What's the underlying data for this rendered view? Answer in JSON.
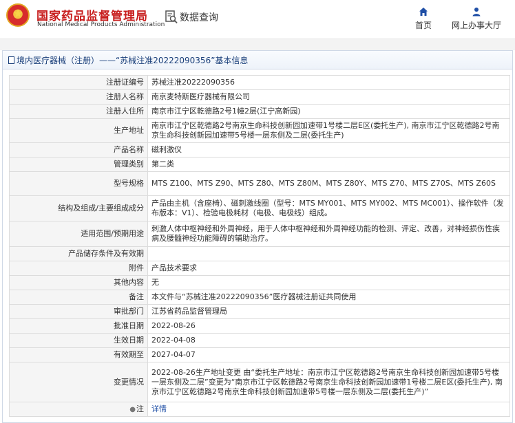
{
  "header": {
    "brand_cn": "国家药品监督管理局",
    "brand_en": "National Medical Products Administration",
    "query_label": "数据查询",
    "nav": [
      {
        "label": "首页",
        "icon": "home-icon"
      },
      {
        "label": "网上办事大厅",
        "icon": "user-icon"
      }
    ]
  },
  "panel": {
    "title": "境内医疗器械（注册）——“苏械注准20222090356”基本信息"
  },
  "rows": [
    {
      "label": "注册证编号",
      "value": "苏械注准20222090356"
    },
    {
      "label": "注册人名称",
      "value": "南京麦特斯医疗器械有限公司"
    },
    {
      "label": "注册人住所",
      "value": "南京市江宁区乾德路2号1幢2层(江宁高新园)"
    },
    {
      "label": "生产地址",
      "value": "南京市江宁区乾德路2号南京生命科技创新园加速带1号楼二层E区(委托生产), 南京市江宁区乾德路2号南京生命科技创新园加速带5号楼一层东侧及二层(委托生产)"
    },
    {
      "label": "产品名称",
      "value": "磁刺激仪"
    },
    {
      "label": "管理类别",
      "value": "第二类"
    },
    {
      "label": "型号规格",
      "value": "MTS Z100、MTS Z90、MTS Z80、MTS Z80M、MTS Z80Y、MTS Z70、MTS Z70S、MTS Z60S"
    },
    {
      "label": "结构及组成/主要组成成分",
      "value": "产品由主机（含座椅）、磁刺激线圈（型号：MTS MY001、MTS MY002、MTS MC001）、操作软件（发布版本：V1）、检验电极耗材（电极、电极线）组成。"
    },
    {
      "label": "适用范围/预期用途",
      "value": "刺激人体中枢神经和外周神经，用于人体中枢神经和外周神经功能的检测、评定、改善，对神经损伤性疾病及腰髓神经功能障碍的辅助治疗。"
    },
    {
      "label": "产品储存条件及有效期",
      "value": ""
    },
    {
      "label": "附件",
      "value": "产品技术要求"
    },
    {
      "label": "其他内容",
      "value": "无"
    },
    {
      "label": "备注",
      "value": "本文件与“苏械注准20222090356”医疗器械注册证共同使用"
    },
    {
      "label": "审批部门",
      "value": "江苏省药品监督管理局"
    },
    {
      "label": "批准日期",
      "value": "2022-08-26"
    },
    {
      "label": "生效日期",
      "value": "2022-04-08"
    },
    {
      "label": "有效期至",
      "value": "2027-04-07"
    },
    {
      "label": "变更情况",
      "value": "2022-08-26生产地址变更 由“委托生产地址：南京市江宁区乾德路2号南京生命科技创新园加速带5号楼一层东侧及二层”变更为“南京市江宁区乾德路2号南京生命科技创新园加速带1号楼二层E区(委托生产), 南京市江宁区乾德路2号南京生命科技创新园加速带5号楼一层东侧及二层(委托生产)”"
    }
  ],
  "note": {
    "label": "注",
    "icon": "bulb-icon",
    "link": "详情"
  }
}
